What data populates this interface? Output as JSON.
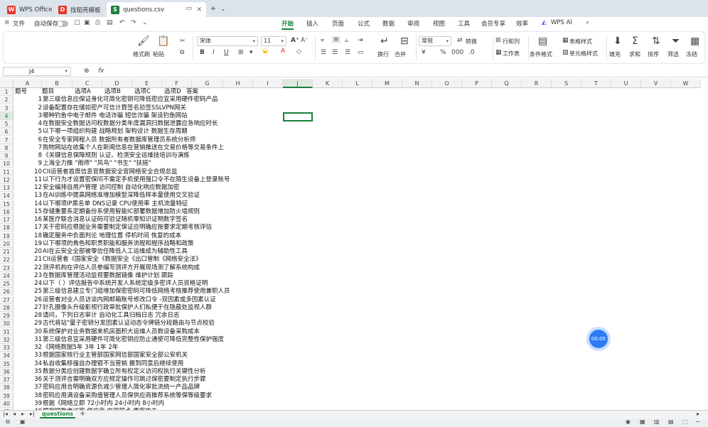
{
  "window": {
    "tabs": [
      {
        "label": "WPS Office",
        "icon": "wps-logo-icon",
        "color": "#e5352b"
      },
      {
        "label": "找稻壳模板",
        "icon": "docer-icon",
        "color": "#e5352b"
      },
      {
        "label": "questions.csv",
        "icon": "spreadsheet-icon",
        "color": "#1a7f3c"
      }
    ],
    "add_tab": "+"
  },
  "menubar": {
    "file": "文件",
    "autosave": "自动保存",
    "items": [
      "开始",
      "插入",
      "页面",
      "公式",
      "数据",
      "审阅",
      "视图",
      "工具",
      "会员专享",
      "效率",
      "WPS AI"
    ],
    "active": "开始"
  },
  "ribbon": {
    "format_painter": "格式刷",
    "paste": "粘贴",
    "font_name": "宋体",
    "font_size": "11",
    "align_wrap": "换行",
    "merge": "合并",
    "number_format": "常规",
    "convert": "转换",
    "row_col": "行和列",
    "worksheet": "工作表",
    "cond_format": "条件格式",
    "table_style": "表格样式",
    "cell_style": "单元格样式",
    "fill": "填充",
    "sum": "求和",
    "sort": "排序",
    "filter": "筛选",
    "freeze": "冻结"
  },
  "formula_bar": {
    "name_box": "J4",
    "fx": "fx",
    "value": ""
  },
  "grid": {
    "columns": [
      "A",
      "B",
      "C",
      "D",
      "E",
      "F",
      "G",
      "H",
      "I",
      "J",
      "K",
      "L",
      "M",
      "N",
      "O",
      "P",
      "Q",
      "R",
      "S",
      "T",
      "U",
      "V",
      "W"
    ],
    "selected_col": "J",
    "selected_row": "4",
    "header_row": [
      "题号",
      "题目",
      "选项A",
      "选项B",
      "选项C",
      "选项D",
      "答案"
    ],
    "rows": [
      [
        "1",
        "第三级信息应保证身化可简化密钥可降低密应宜采用硬件密码产品"
      ],
      [
        "2",
        "设备配置存在储如密产可信计算签名验签SSLVPN网关"
      ],
      [
        "3",
        "哪种钓鱼中电子邮件 电话诈骗 短信诈骗 架设钓鱼网站"
      ],
      [
        "4",
        "在数据安全数据访问权数据分类年度漏洞扫数据泄露应急响应时长"
      ],
      [
        "5",
        "以下哪一项组织构建 战略规划 架构设计 数据生存周期"
      ],
      [
        "6",
        "在安全专家网程人员 数据所有者数据库管理员系统分析师"
      ],
      [
        "7",
        "购物网站在收集个人在新闻信息在营销推送在交易价格等交易条件上"
      ],
      [
        "8",
        "《关键信息保障规则 认证、检测安全运维技培训与演练"
      ],
      [
        "9",
        "上海全力推 \"雨师\" \"风鸟\" \"书生\" \"扶摇\""
      ],
      [
        "10",
        "CII运营者首席信息官数据安全官网络安全合规总监"
      ],
      [
        "11",
        "以下行为才设置密保问不需定手机使用强口令不在陌生设备上登录账号"
      ],
      [
        "12",
        "安全编排自用户管理 访问控制 自动化响应数据加密"
      ],
      [
        "13",
        "在AI训练中提高网络准增加模型深降低样本量使用交叉验证"
      ],
      [
        "14",
        "以下哪项IP黑名单 DNS记录 CPU使用率 主机流量特征"
      ],
      [
        "15",
        "存储重要系定期备份系使用智能IC部署数据增加防火墙规则"
      ],
      [
        "16",
        "某医疗联合消息认证码可验证随机零知识证明数字签名"
      ],
      [
        "17",
        "关于密码应根据业务需要制定保证应明确应按要求定期考核评估"
      ],
      [
        "18",
        "确定服务中负面判论 地理位置 停机时间 恢复的成本"
      ],
      [
        "19",
        "以下哪项的角色和职责职能和服务流程和程序战略和政策"
      ],
      [
        "20",
        "AI在云安全全部被零信任降低人工运维成为辅助性工具"
      ],
      [
        "21",
        "CII运营者《国家安全《数据安全《出口管制《网络安全法》"
      ],
      [
        "22",
        "测评机构在评估人员参编写测评方开展现场测了解系统构成"
      ],
      [
        "23",
        "在数据库管理活动监视要数据镜像 维护计划 跟踪"
      ],
      [
        "24",
        "以下（ ）评估报告中系统开发人系统定级多密评人员资格证明"
      ],
      [
        "25",
        "第三级信息建立专门组增加保密密码可降低网络考核推荐使用兼职人员"
      ],
      [
        "26",
        "运营者对业人员访谈内网邮箱账号修改口令 -双因素或多因素认证"
      ],
      [
        "27",
        "针孔摄像头升级影视行政审批保护人们私便于在隐蔽处监视人群"
      ],
      [
        "28",
        "请问，下列日志审计 自动化工具归档日志 冗余日志"
      ],
      [
        "29",
        "古代将站\"量子密钥分发因素认证动态令牌链分段路由与节点校验"
      ],
      [
        "30",
        "系统保护对业务数据来机房面积大运维人员数设备采购成本"
      ],
      [
        "31",
        "第三级信息宜采用硬件可简化密钥应防止通使可降低完整性保护强度"
      ],
      [
        "32",
        "《网络数据5年 3年 1年 2年"
      ],
      [
        "33",
        "根据国家核行业主管部国家网信部国家安全部公安机关"
      ],
      [
        "34",
        "私自收集移撞自办理银不当营销 搬到同意后继续使用"
      ],
      [
        "35",
        "数据分类应创建数据字确立所有权定义访问权执行关键性分析"
      ],
      [
        "36",
        "关于测评合需明确双方应规定操作可跳过保密要制定执行步骤"
      ],
      [
        "37",
        "密码应用合明确资源负减少管理人简化审批流统一产品品牌"
      ],
      [
        "38",
        "密码应用满设备采购值管理人员保供应商推荐系统等保等级要求"
      ],
      [
        "39",
        "根据《网络立即 72小时内 24小时内 8小时内"
      ],
      [
        "40",
        "根据短数者访客 供应商 内部弱点 黑客攻击"
      ]
    ]
  },
  "sheet_tabs": {
    "active": "questions",
    "add": "+"
  },
  "badge": {
    "label": "00:05"
  },
  "colors": {
    "accent": "#1a7f3c",
    "badge": "#2d7cf6"
  }
}
